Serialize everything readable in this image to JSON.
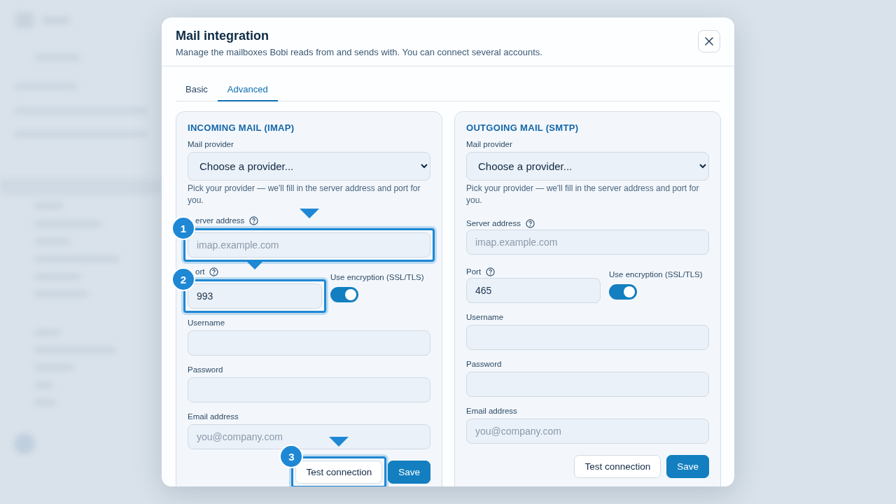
{
  "dialog": {
    "title": "Mail integration",
    "subtitle": "Manage the mailboxes Bobi reads from and sends with. You can connect several accounts."
  },
  "tabs": [
    {
      "label": "Basic",
      "selected": false
    },
    {
      "label": "Advanced",
      "selected": true
    }
  ],
  "cards": [
    {
      "title": "INCOMING MAIL (IMAP)",
      "provider": {
        "label": "Mail provider",
        "value": "Choose a provider...",
        "hint": "Pick your provider — we'll fill in the server address and port for you."
      },
      "server": {
        "label": "erver address",
        "placeholder": "imap.example.com",
        "tour_step": "1"
      },
      "port": {
        "label": "ort",
        "value": "993",
        "tour_step": "2"
      },
      "encryption": {
        "label": "Use encryption (SSL/TLS)",
        "on": true
      },
      "username": {
        "label": "Username"
      },
      "password": {
        "label": "Password"
      },
      "email": {
        "label": "Email address",
        "placeholder": "you@company.com"
      },
      "buttons": [
        {
          "label": "Test connection",
          "kind": "secondary",
          "tour_step": "3"
        },
        {
          "label": "Save",
          "kind": "primary"
        }
      ]
    },
    {
      "title": "OUTGOING MAIL (SMTP)",
      "provider": {
        "label": "Mail provider",
        "value": "Choose a provider...",
        "hint": "Pick your provider — we'll fill in the server address and port for you."
      },
      "server": {
        "label": "Server address",
        "placeholder": "imap.example.com"
      },
      "port": {
        "label": "Port",
        "value": "465"
      },
      "encryption": {
        "label": "Use encryption (SSL/TLS)",
        "on": true
      },
      "username": {
        "label": "Username"
      },
      "password": {
        "label": "Password"
      },
      "email": {
        "label": "Email address",
        "placeholder": "you@company.com"
      },
      "buttons": [
        {
          "label": "Test connection",
          "kind": "secondary"
        },
        {
          "label": "Save",
          "kind": "primary"
        }
      ]
    }
  ]
}
